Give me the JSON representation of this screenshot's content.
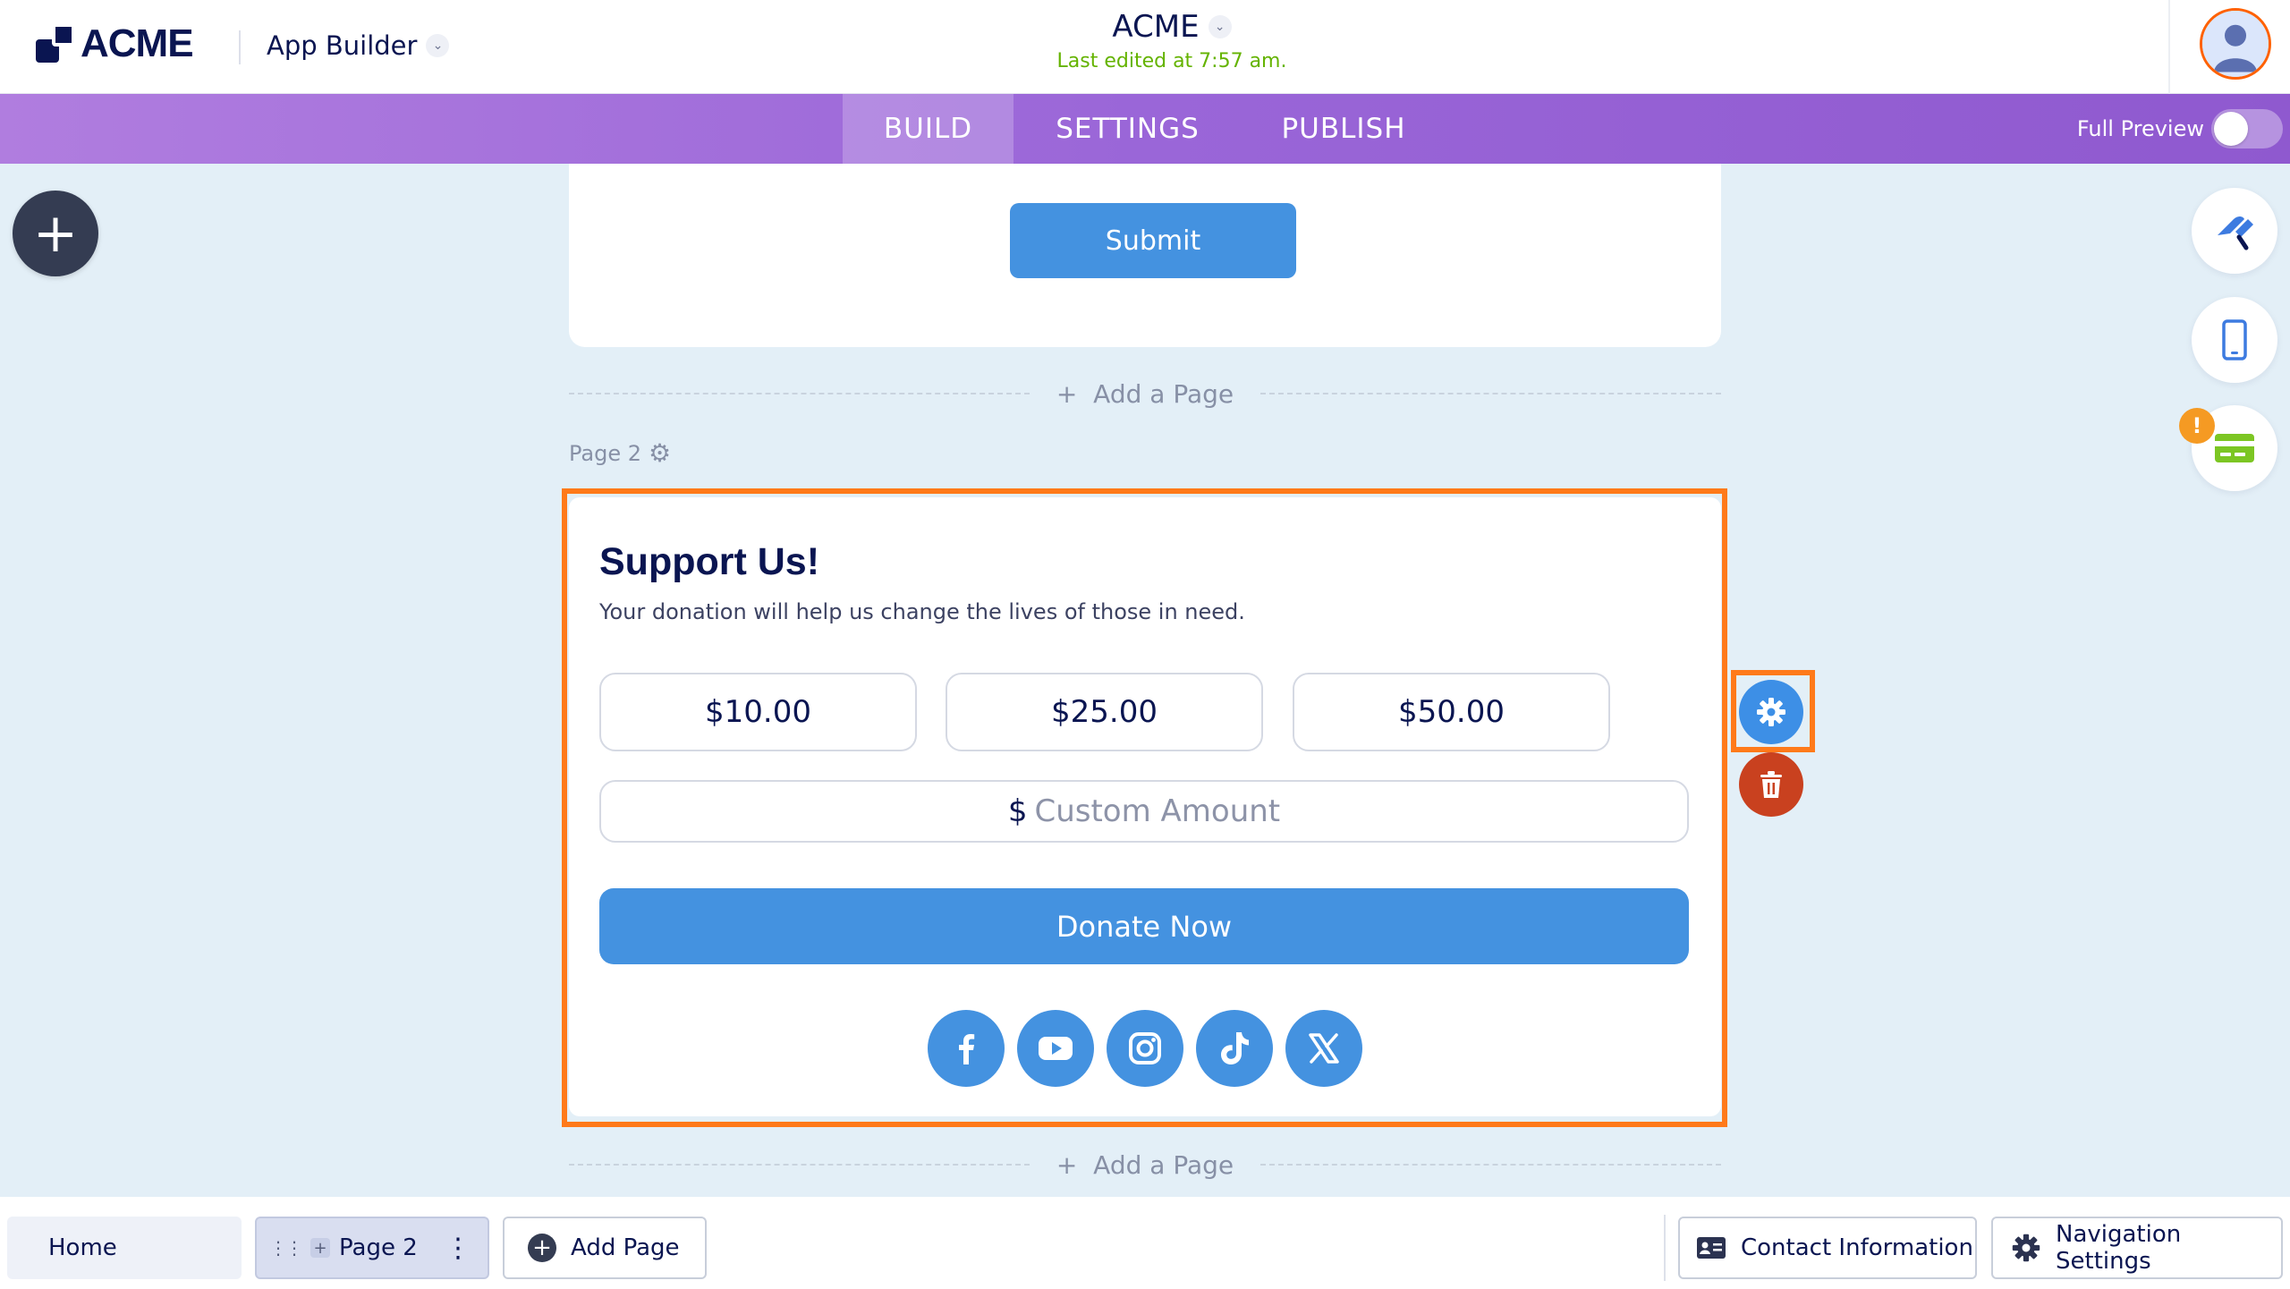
{
  "header": {
    "logo_text": "ACME",
    "app_builder_label": "App Builder",
    "form_title": "ACME",
    "last_edited": "Last edited at 7:57 am."
  },
  "nav": {
    "tabs": [
      {
        "label": "BUILD",
        "active": true
      },
      {
        "label": "SETTINGS",
        "active": false
      },
      {
        "label": "PUBLISH",
        "active": false
      }
    ],
    "full_preview_label": "Full Preview",
    "full_preview_on": false
  },
  "canvas": {
    "submit_label": "Submit",
    "add_page_label": "Add a Page",
    "page2_label": "Page 2",
    "donation": {
      "heading": "Support Us!",
      "subtext": "Your donation will help us change the lives of those in need.",
      "amounts": [
        "$10.00",
        "$25.00",
        "$50.00"
      ],
      "currency_symbol": "$",
      "custom_placeholder": "Custom Amount",
      "donate_label": "Donate Now",
      "socials": [
        "facebook-icon",
        "youtube-icon",
        "instagram-icon",
        "tiktok-icon",
        "x-icon"
      ]
    }
  },
  "bottom_bar": {
    "home_label": "Home",
    "page2_label": "Page 2",
    "add_page_label": "Add Page",
    "contact_label": "Contact Information",
    "nav_settings_label": "Navigation Settings"
  },
  "colors": {
    "accent_blue": "#4492e0",
    "selection_orange": "#ff7a1a",
    "delete_red": "#c9411f",
    "edited_green": "#64b300",
    "nav_purple": "#9a66d8"
  }
}
